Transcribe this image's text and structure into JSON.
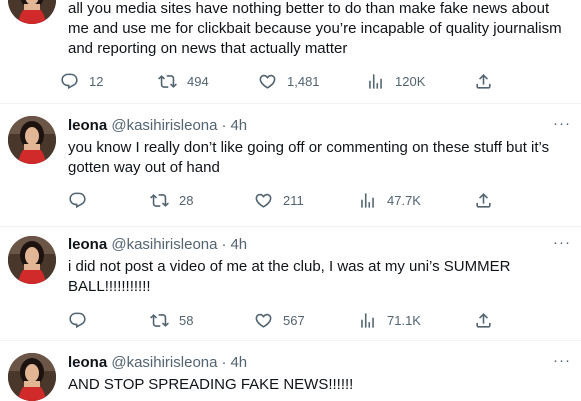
{
  "tweets": [
    {
      "text": "all you media sites have nothing better to do than make fake news about me and use me for clickbait because you’re incapable of quality journalism and reporting on news that actually matter",
      "replies": "12",
      "retweets": "494",
      "likes": "1,481",
      "views": "120K"
    },
    {
      "name": "leona",
      "handle": "@kasihirisleona",
      "dot": "·",
      "time": "4h",
      "text": "you know I really don’t like going off or commenting on these stuff but it’s gotten way out of hand",
      "replies": "",
      "retweets": "28",
      "likes": "211",
      "views": "47.7K"
    },
    {
      "name": "leona",
      "handle": "@kasihirisleona",
      "dot": "·",
      "time": "4h",
      "text": "i did not post a video of me at the club, I was at my uni’s SUMMER BALL!!!!!!!!!!!",
      "replies": "",
      "retweets": "58",
      "likes": "567",
      "views": "71.1K"
    },
    {
      "name": "leona",
      "handle": "@kasihirisleona",
      "dot": "·",
      "time": "4h",
      "text": "AND STOP SPREADING FAKE NEWS!!!!!!"
    }
  ],
  "more_label": "···",
  "icons": [
    "reply-icon",
    "retweet-icon",
    "like-icon",
    "views-icon",
    "share-icon",
    "more-icon"
  ],
  "colors": {
    "text": "#0f1419",
    "secondary": "#536471",
    "divider": "#eff3f4",
    "dress": "#d12a2a"
  }
}
